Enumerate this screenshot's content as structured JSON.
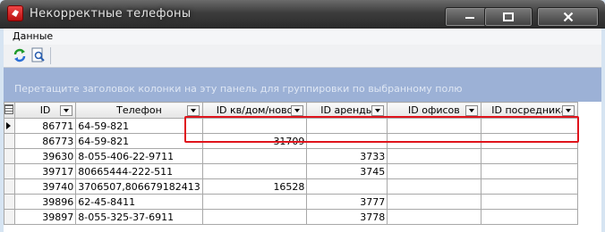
{
  "window": {
    "title": "Некорректные телефоны",
    "controls": {
      "minimize": "minimize",
      "maximize": "maximize",
      "close": "close"
    }
  },
  "menu": {
    "items": [
      {
        "label": "Данные"
      }
    ]
  },
  "toolbar": {
    "icons": [
      "refresh-icon",
      "search-icon"
    ]
  },
  "group_panel": {
    "hint": "Перетащите заголовок колонки на эту панель для группировки по выбранному полю"
  },
  "grid": {
    "columns": [
      "ID",
      "Телефон",
      "ID кв/дом/ново",
      "ID аренды",
      "ID офисов",
      "ID посредника"
    ],
    "rows": [
      {
        "id": "86771",
        "phone": "64-59-821",
        "kv": "",
        "arenda": "",
        "office": "",
        "posrednik": "",
        "current": true
      },
      {
        "id": "86773",
        "phone": "64-59-821",
        "kv": "31709",
        "arenda": "",
        "office": "",
        "posrednik": ""
      },
      {
        "id": "39630",
        "phone": "8-055-406-22-9711",
        "kv": "",
        "arenda": "3733",
        "office": "",
        "posrednik": ""
      },
      {
        "id": "39717",
        "phone": "80665444-222-511",
        "kv": "",
        "arenda": "3745",
        "office": "",
        "posrednik": ""
      },
      {
        "id": "39740",
        "phone": "3706507,806679182413",
        "kv": "16528",
        "arenda": "",
        "office": "",
        "posrednik": ""
      },
      {
        "id": "39896",
        "phone": "62-45-8411",
        "kv": "",
        "arenda": "3777",
        "office": "",
        "posrednik": ""
      },
      {
        "id": "39897",
        "phone": "8-055-325-37-6911",
        "kv": "",
        "arenda": "3778",
        "office": "",
        "posrednik": ""
      }
    ]
  },
  "colors": {
    "highlight": "#e0141c",
    "group_panel": "#9cb1d6"
  }
}
